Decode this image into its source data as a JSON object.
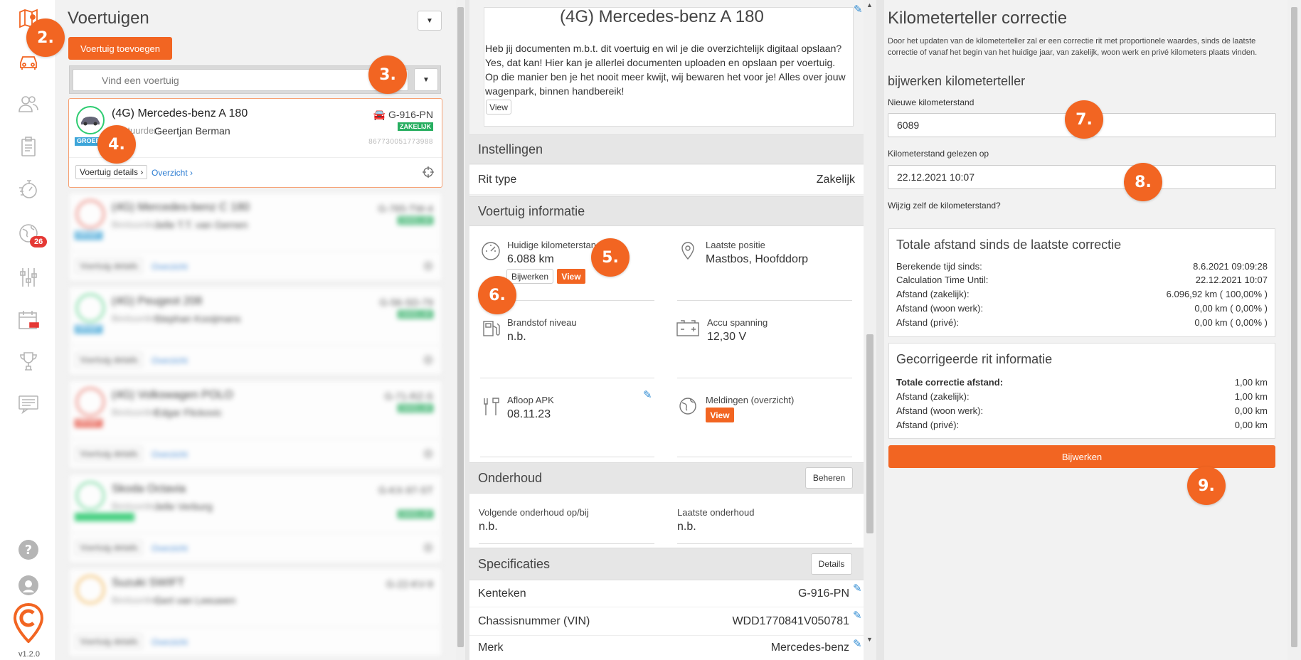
{
  "sidebar": {
    "badge_count": "26",
    "version": "v1.2.0",
    "icons": [
      "map-icon",
      "car-icon",
      "users-icon",
      "clipboard-icon",
      "stopwatch-icon",
      "globe-icon",
      "sliders-icon",
      "calendar-car-icon",
      "trophy-icon",
      "chat-icon",
      "help-icon",
      "support-icon",
      "logo-icon"
    ]
  },
  "steps": {
    "s2": "2.",
    "s3": "3.",
    "s4": "4.",
    "s5": "5.",
    "s6": "6.",
    "s7": "7.",
    "s8": "8.",
    "s9": "9."
  },
  "vehicles_panel": {
    "title": "Voertuigen",
    "add_button": "Voertuig toevoegen",
    "search_placeholder": "Vind een voertuig",
    "vehicles": [
      {
        "name": "(4G) Mercedes-benz A 180",
        "driver_label": "Bestuurder:",
        "driver": "Geertjan Berman",
        "plate": "G-916-PN",
        "tag": "ZAKELIJK",
        "number": "867730051773988",
        "group": "GROEP",
        "details": "Voertuig details ›",
        "overview": "Overzicht ›"
      },
      {
        "name": "(4G) Mercedes-benz C 180",
        "driver_label": "Bestuurder:",
        "driver": "Jelle T.T. van Gernen",
        "plate": "G-765-TW-4",
        "tag": "ZAKELIJK",
        "number": "",
        "group": "GROEP",
        "details": "Voertuig details",
        "overview": "Overzicht"
      },
      {
        "name": "(4G) Peugeot 208",
        "driver_label": "Bestuurder:",
        "driver": "Stephan Kooijmans",
        "plate": "G-56-SD-79",
        "tag": "ZAKELIJK",
        "number": "",
        "group": "GROEP",
        "details": "Voertuig details",
        "overview": "Overzicht"
      },
      {
        "name": "(4G) Volkswagen POLO",
        "driver_label": "Bestuurder:",
        "driver": "Edgar Flickovic",
        "plate": "G-71-RZ-S",
        "tag": "ZAKELIJK",
        "number": "",
        "group": "GROEP",
        "details": "Voertuig details",
        "overview": "Overzicht"
      },
      {
        "name": "Skoda Octavia",
        "driver_label": "Bestuurder:",
        "driver": "Jelle Verburg",
        "plate": "G-KX-97-ST",
        "tag": "ZAKELIJK",
        "number": "",
        "group": "",
        "details": "Voertuig details",
        "overview": "Overzicht"
      },
      {
        "name": "Suzuki SWIFT",
        "driver_label": "Bestuurder:",
        "driver": "Gert van Leeuwen",
        "plate": "G-22-KV-9",
        "tag": "",
        "number": "",
        "group": "",
        "details": "Voertuig details",
        "overview": "Overzicht"
      }
    ]
  },
  "vehicle_detail": {
    "title": "(4G) Mercedes-benz A 180",
    "doc_text": "Heb jij documenten m.b.t. dit voertuig en wil je die overzichtelijk digitaal opslaan? Yes, dat kan! Hier kan je allerlei documenten uploaden en opslaan per voertuig. Op die manier ben je het nooit meer kwijt, wij bewaren het voor je! Alles over jouw wagenpark, binnen handbereik!",
    "doc_view": "View",
    "settings_title": "Instellingen",
    "rit_type_label": "Rit type",
    "rit_type_value": "Zakelijk",
    "info_title": "Voertuig informatie",
    "odometer_label": "Huidige kilometerstand",
    "odometer_value": "6.088 km",
    "update_btn": "Bijwerken",
    "view_btn": "View",
    "position_label": "Laatste positie",
    "position_value": "Mastbos, Hoofddorp",
    "fuel_label": "Brandstof niveau",
    "fuel_value": "n.b.",
    "battery_label": "Accu spanning",
    "battery_value": "12,30 V",
    "apk_label": "Afloop APK",
    "apk_value": "08.11.23",
    "alerts_label": "Meldingen (overzicht)",
    "alerts_view": "View",
    "maintenance_title": "Onderhoud",
    "maintenance_btn": "Beheren",
    "next_maint_label": "Volgende onderhoud op/bij",
    "next_maint_value": "n.b.",
    "last_maint_label": "Laatste onderhoud",
    "last_maint_value": "n.b.",
    "specs_title": "Specificaties",
    "specs_btn": "Details",
    "plate_label": "Kenteken",
    "plate_value": "G-916-PN",
    "vin_label": "Chassisnummer (VIN)",
    "vin_value": "WDD1770841V050781",
    "brand_label": "Merk",
    "brand_value": "Mercedes-benz"
  },
  "correction": {
    "title": "Kilometerteller correctie",
    "description": "Door het updaten van de kilometerteller zal er een correctie rit met proportionele waardes, sinds de laatste correctie of vanaf het begin van het huidige jaar, van zakelijk, woon werk en privé kilometers plaats vinden.",
    "subtitle": "bijwerken kilometerteller",
    "new_label": "Nieuwe kilometerstand",
    "new_value": "6089",
    "read_label": "Kilometerstand gelezen op",
    "read_value": "22.12.2021 10:07",
    "self_change": "Wijzig zelf de kilometerstand?",
    "total_title": "Totale afstand sinds de laatste correctie",
    "total_rows": [
      {
        "k": "Berekende tijd sinds:",
        "v": "8.6.2021 09:09:28"
      },
      {
        "k": "Calculation Time Until:",
        "v": "22.12.2021 10:07"
      },
      {
        "k": "Afstand (zakelijk):",
        "v": "6.096,92 km ( 100,00% )"
      },
      {
        "k": "Afstand (woon werk):",
        "v": "0,00 km ( 0,00% )"
      },
      {
        "k": "Afstand (privé):",
        "v": "0,00 km ( 0,00% )"
      }
    ],
    "corr_title": "Gecorrigeerde rit informatie",
    "corr_rows": [
      {
        "k": "Totale correctie afstand:",
        "v": "1,00 km"
      },
      {
        "k": "Afstand (zakelijk):",
        "v": "1,00 km"
      },
      {
        "k": "Afstand (woon werk):",
        "v": "0,00 km"
      },
      {
        "k": "Afstand (privé):",
        "v": "0,00 km"
      }
    ],
    "update_btn": "Bijwerken"
  },
  "colors": {
    "accent": "#f26522",
    "link": "#2d7dd2",
    "tag_green": "#27ae60"
  }
}
